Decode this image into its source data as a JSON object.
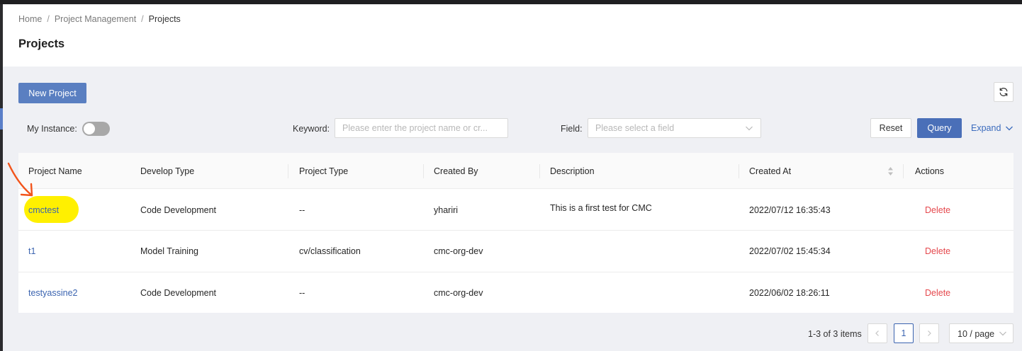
{
  "breadcrumb": [
    "Home",
    "Project Management",
    "Projects"
  ],
  "page_title": "Projects",
  "toolbar": {
    "new_project": "New Project"
  },
  "filters": {
    "my_instance_label": "My Instance",
    "my_instance_on": false,
    "keyword_label": "Keyword",
    "keyword_placeholder": "Please enter the project name or cr...",
    "field_label": "Field",
    "field_placeholder": "Please select a field",
    "reset": "Reset",
    "query": "Query",
    "expand": "Expand"
  },
  "table": {
    "columns": [
      "Project Name",
      "Develop Type",
      "Project Type",
      "Created By",
      "Description",
      "Created At",
      "Actions"
    ],
    "rows": [
      {
        "name": "cmctest",
        "develop_type": "Code Development",
        "project_type": "--",
        "created_by": "yhariri",
        "description": "This is a first test for CMC",
        "created_at": "2022/07/12 16:35:43",
        "action": "Delete"
      },
      {
        "name": "t1",
        "develop_type": "Model Training",
        "project_type": "cv/classification",
        "created_by": "cmc-org-dev",
        "description": "",
        "created_at": "2022/07/02 15:45:34",
        "action": "Delete"
      },
      {
        "name": "testyassine2",
        "develop_type": "Code Development",
        "project_type": "--",
        "created_by": "cmc-org-dev",
        "description": "",
        "created_at": "2022/06/02 18:26:11",
        "action": "Delete"
      }
    ]
  },
  "pagination": {
    "total_text": "1-3 of 3 items",
    "current_page": "1",
    "page_size": "10 / page"
  },
  "colors": {
    "primary": "#4a6fb8",
    "link": "#3b64b0",
    "danger": "#e5484d",
    "highlight": "#fff000",
    "annotation_arrow": "#f2541b"
  }
}
